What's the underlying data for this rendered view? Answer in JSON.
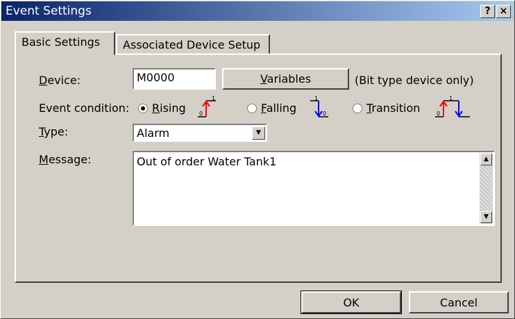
{
  "window": {
    "title": "Event Settings",
    "help_label": "?",
    "close_label": "×"
  },
  "tabs": [
    {
      "label": "Basic Settings",
      "active": true
    },
    {
      "label": "Associated Device Setup",
      "active": false
    }
  ],
  "device": {
    "label_key": "D",
    "label_rest": "evice:",
    "value": "M0000",
    "variables_key": "V",
    "variables_rest": "ariables",
    "note": "(Bit type device only)"
  },
  "event_condition": {
    "label": "Event condition:",
    "selected": "rising",
    "options": [
      {
        "id": "rising",
        "key": "R",
        "rest": "ising"
      },
      {
        "id": "falling",
        "key": "F",
        "rest": "alling"
      },
      {
        "id": "transition",
        "key": "T",
        "rest": "ransition"
      }
    ]
  },
  "type": {
    "label_key": "T",
    "label_rest": "ype:",
    "value": "Alarm"
  },
  "message": {
    "label_key": "M",
    "label_rest": "essage:",
    "value": "Out of order Water Tank1"
  },
  "buttons": {
    "ok": "OK",
    "cancel": "Cancel"
  },
  "colors": {
    "rising_edge": "#ff0000",
    "falling_edge": "#0000ff"
  }
}
